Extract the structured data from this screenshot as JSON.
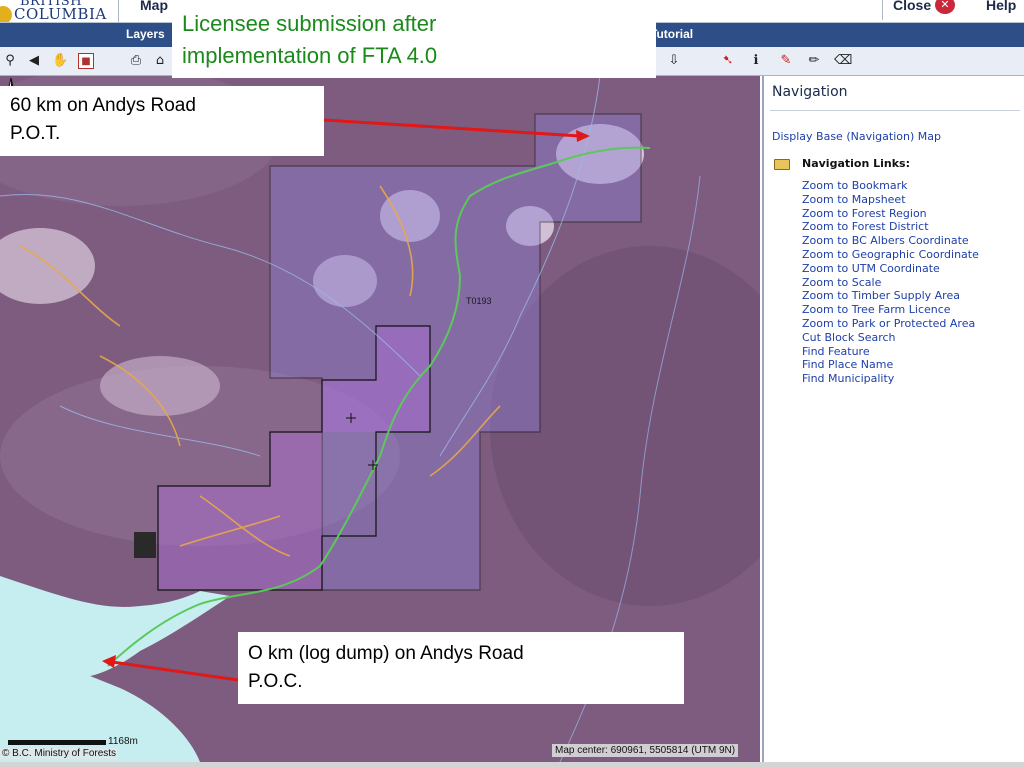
{
  "header": {
    "logo_line1": "BRITISH",
    "logo_line2": "COLUMBIA",
    "app_title": "Map",
    "close_label": "Close",
    "help_label": "Help"
  },
  "menu": {
    "items": [
      "Layers",
      "Tutorial"
    ]
  },
  "toolbar": {
    "icons": [
      "zoom-icon",
      "back-icon",
      "pan-hand-icon",
      "map-box-icon",
      "print-icon",
      "save-icon",
      "download-icon",
      "select-icon",
      "identify-icon",
      "measure-icon",
      "draw-icon",
      "eraser-icon"
    ]
  },
  "annotations": {
    "title_line1": "Licensee submission after",
    "title_line2": "implementation of  FTA 4.0",
    "pot_line1": "60 km on Andys Road",
    "pot_line2": "P.O.T.",
    "poc_line1": "O km (log dump) on Andys Road",
    "poc_line2": "P.O.C."
  },
  "map": {
    "block_label": "T0193",
    "scale_value": "1168m",
    "copyright": "© B.C. Ministry of Forests",
    "center_readout": "Map center: 690961, 5505814 (UTM 9N)"
  },
  "panel": {
    "title": "Navigation",
    "display_base": "Display Base (Navigation) Map",
    "links_heading": "Navigation Links:",
    "links": [
      "Zoom to Bookmark",
      "Zoom to Mapsheet",
      "Zoom to Forest Region",
      "Zoom to Forest District",
      "Zoom to BC Albers Coordinate",
      "Zoom to Geographic Coordinate",
      "Zoom to UTM Coordinate",
      "Zoom to Scale",
      "Zoom to Timber Supply Area",
      "Zoom to Tree Farm Licence",
      "Zoom to Park or Protected Area",
      "Cut Block Search",
      "Find Feature",
      "Find Place Name",
      "Find Municipality"
    ]
  },
  "colors": {
    "menubar": "#2d4e86",
    "link": "#1e3fa8",
    "callout_title": "#1a8a1a",
    "arrow": "#e01818",
    "road": "#5cc85c"
  }
}
